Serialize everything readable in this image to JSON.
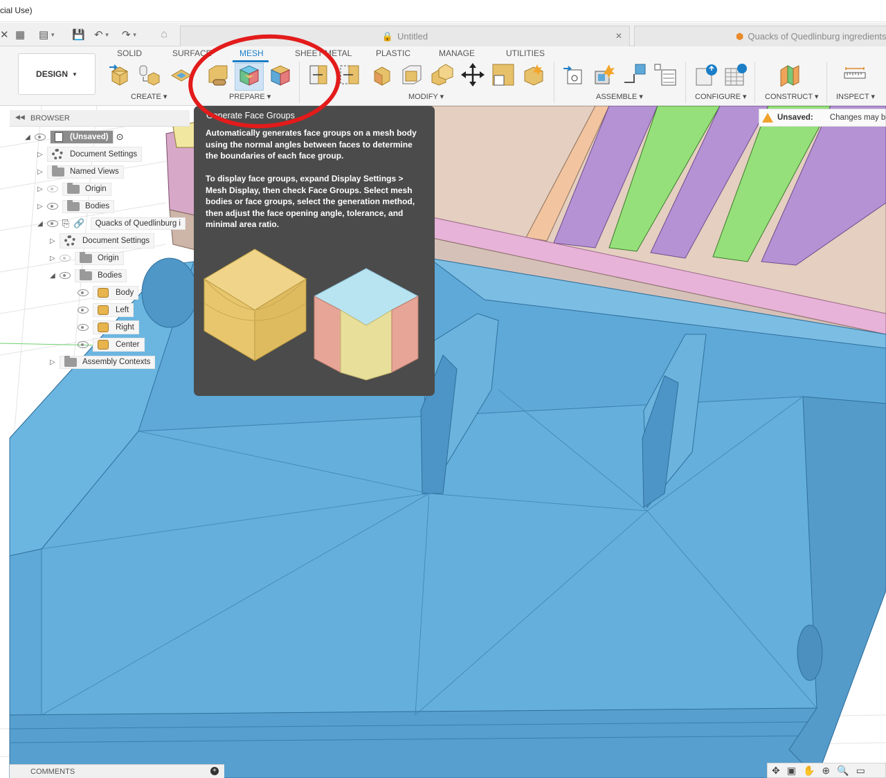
{
  "window": {
    "title": "cial Use)"
  },
  "doc_tabs": [
    {
      "label": "Untitled"
    },
    {
      "label": "Quacks of Quedlinburg ingredients"
    }
  ],
  "ribbon": {
    "workspace_button": "DESIGN",
    "tabs": [
      "SOLID",
      "SURFACE",
      "MESH",
      "SHEET METAL",
      "PLASTIC",
      "MANAGE",
      "UTILITIES"
    ],
    "active_tab": "MESH",
    "groups": [
      "CREATE ▾",
      "PREPARE ▾",
      "MODIFY ▾",
      "ASSEMBLE ▾",
      "CONFIGURE ▾",
      "CONSTRUCT ▾",
      "INSPECT ▾"
    ]
  },
  "browser": {
    "header": "BROWSER",
    "root": "(Unsaved)",
    "items": [
      "Document Settings",
      "Named Views",
      "Origin",
      "Bodies",
      "Quacks of Quedlinburg i",
      "Document Settings",
      "Origin",
      "Bodies",
      "Body",
      "Left",
      "Right",
      "Center",
      "Assembly Contexts"
    ]
  },
  "tooltip": {
    "title": "Generate Face Groups",
    "paragraph1": "Automatically generates face groups on a mesh body using the normal angles between faces to determine the boundaries of each face group.",
    "paragraph2": "To display face groups, expand Display Settings > Mesh Display, then check Face Groups. Select mesh bodies or face groups, select the generation method, then adjust the face opening angle, tolerance, and minimal area ratio."
  },
  "unsaved": {
    "label": "Unsaved:",
    "message": "Changes may be"
  },
  "comments": {
    "label": "COMMENTS"
  },
  "colors": {
    "accent": "#1b7ec7",
    "mesh_blue": "#5ea9d8",
    "annotation_red": "#e31b1b",
    "tooltip_bg": "#4b4b4b"
  }
}
